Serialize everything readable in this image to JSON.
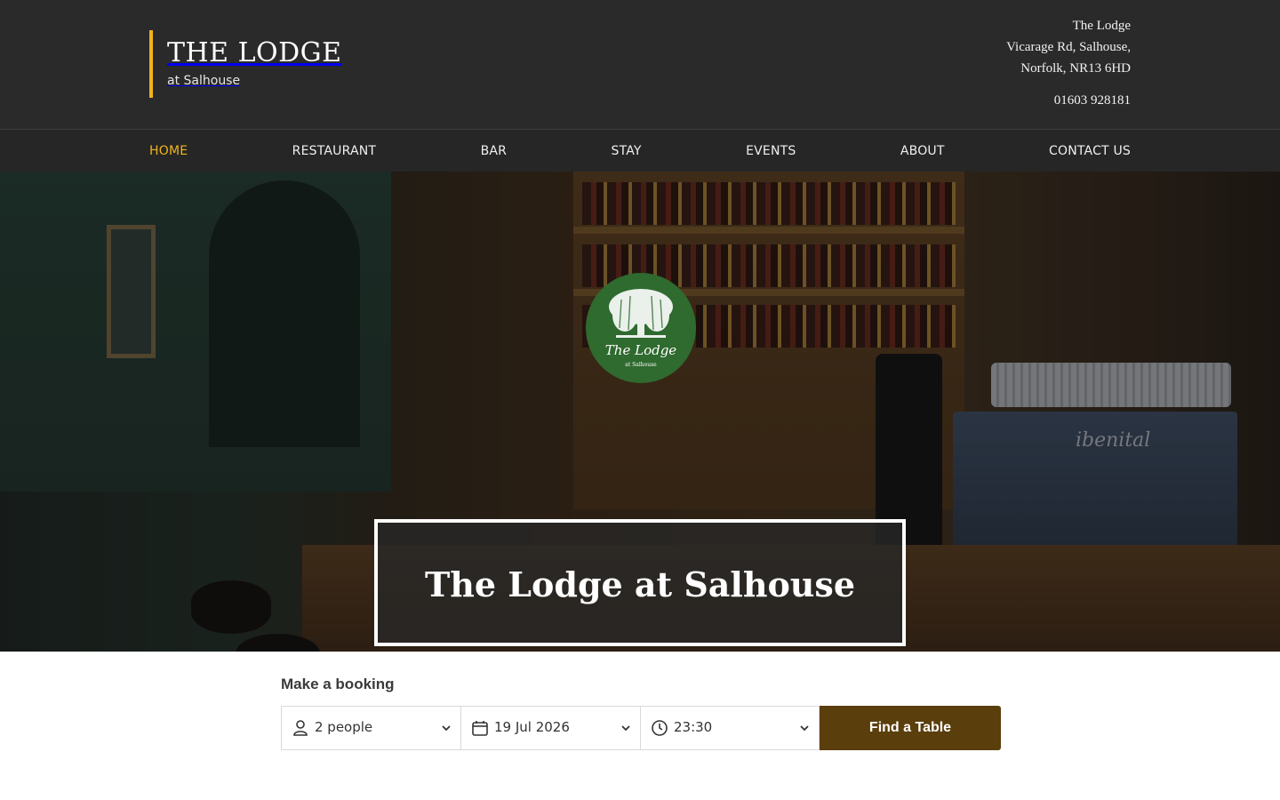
{
  "header": {
    "brand_title": "THE LODGE",
    "brand_sub": "at Salhouse",
    "address_lines": [
      "The Lodge",
      "Vicarage Rd, Salhouse,",
      "Norfolk, NR13 6HD"
    ],
    "phone": "01603 928181",
    "accent_color": "#f0b41c"
  },
  "nav": {
    "items": [
      {
        "label": "HOME",
        "active": true
      },
      {
        "label": "RESTAURANT",
        "active": false
      },
      {
        "label": "BAR",
        "active": false
      },
      {
        "label": "STAY",
        "active": false
      },
      {
        "label": "EVENTS",
        "active": false
      },
      {
        "label": "ABOUT",
        "active": false
      },
      {
        "label": "CONTACT US",
        "active": false
      }
    ]
  },
  "hero": {
    "logo_script": "The Lodge",
    "logo_small": "at Salhouse",
    "title": "The Lodge at Salhouse",
    "machine_label": "ibenital"
  },
  "booking": {
    "heading": "Make a booking",
    "party_size": "2 people",
    "date": "19 Jul 2026",
    "time": "23:30",
    "button_label": "Find a Table",
    "button_color": "#5a3e0c",
    "icons": [
      "person-icon",
      "calendar-icon",
      "clock-icon",
      "chevron-down-icon"
    ]
  }
}
